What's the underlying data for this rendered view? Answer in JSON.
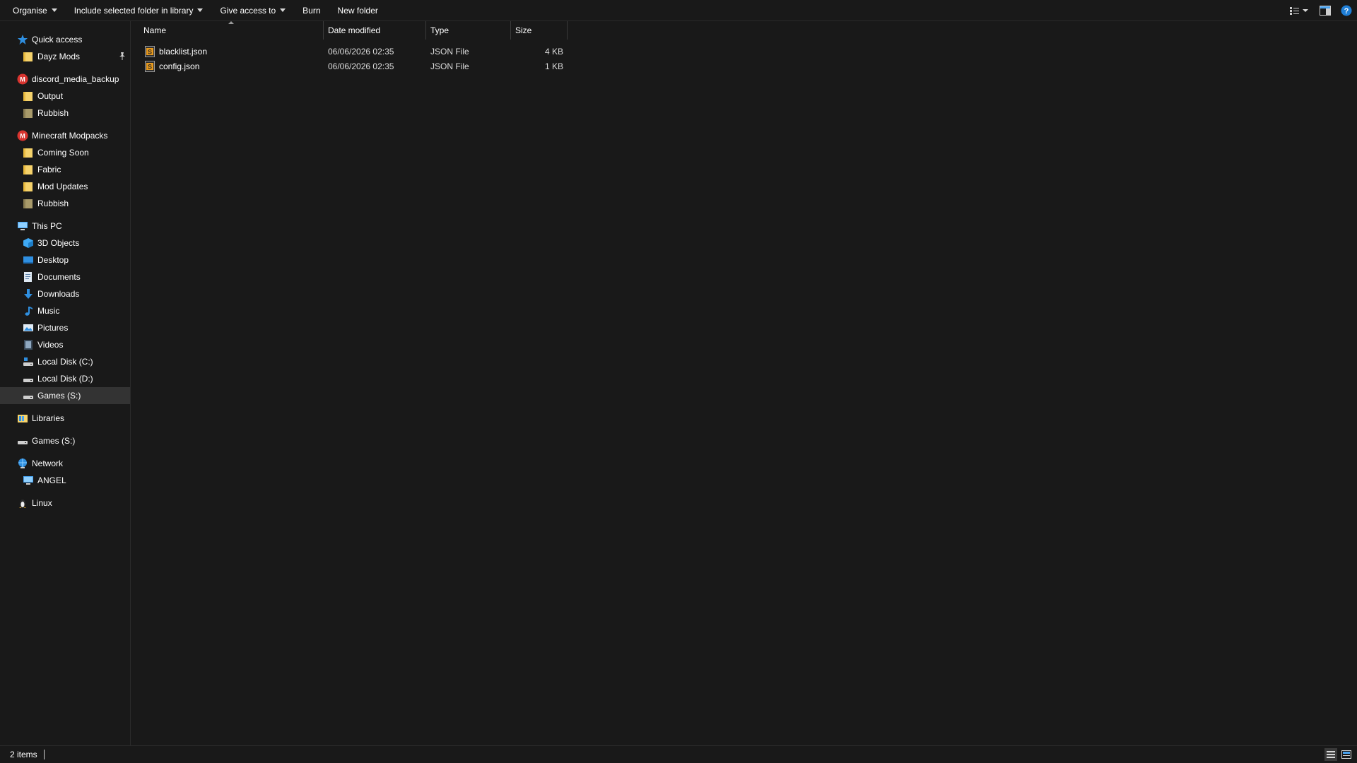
{
  "toolbar": {
    "organise": "Organise",
    "include_library": "Include selected folder in library",
    "give_access": "Give access to",
    "burn": "Burn",
    "new_folder": "New folder"
  },
  "nav": {
    "quick_access": "Quick access",
    "quick_access_items": [
      "Dayz Mods"
    ],
    "discord": "discord_media_backup",
    "discord_items": [
      "Output",
      "Rubbish"
    ],
    "minecraft": "Minecraft Modpacks",
    "minecraft_items": [
      "Coming Soon",
      "Fabric",
      "Mod Updates",
      "Rubbish"
    ],
    "this_pc": "This PC",
    "this_pc_items": [
      "3D Objects",
      "Desktop",
      "Documents",
      "Downloads",
      "Music",
      "Pictures",
      "Videos",
      "Local Disk (C:)",
      "Local Disk (D:)",
      "Games (S:)"
    ],
    "libraries": "Libraries",
    "games": "Games (S:)",
    "network": "Network",
    "network_items": [
      "ANGEL"
    ],
    "linux": "Linux"
  },
  "columns": {
    "name": "Name",
    "date": "Date modified",
    "type": "Type",
    "size": "Size"
  },
  "files": [
    {
      "name": "blacklist.json",
      "date": "06/06/2026 02:35",
      "type": "JSON File",
      "size": "4 KB"
    },
    {
      "name": "config.json",
      "date": "06/06/2026 02:35",
      "type": "JSON File",
      "size": "1 KB"
    }
  ],
  "status": {
    "items": "2 items"
  },
  "colors": {
    "background": "#191919",
    "selected": "#333333",
    "folder": "#f5d26b",
    "accent_blue": "#2f8fe0",
    "drive_red": "#d8342f"
  }
}
